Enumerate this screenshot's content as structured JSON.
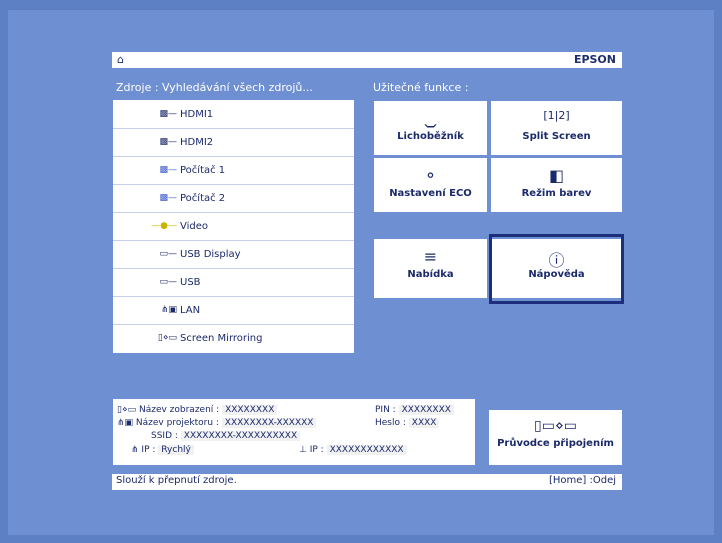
{
  "header": {
    "home_icon": "home-icon",
    "brand": "EPSON"
  },
  "sources": {
    "title": "Zdroje : Vyhledávání všech zdrojů...",
    "items": [
      {
        "label": "HDMI1",
        "icon": "hdmi-cable-icon"
      },
      {
        "label": "HDMI2",
        "icon": "hdmi-cable-icon"
      },
      {
        "label": "Počítač 1",
        "icon": "vga-cable-icon"
      },
      {
        "label": "Počítač 2",
        "icon": "vga-cable-icon"
      },
      {
        "label": "Video",
        "icon": "video-cable-icon"
      },
      {
        "label": "USB Display",
        "icon": "usb-display-cable-icon"
      },
      {
        "label": "USB",
        "icon": "usb-cable-icon"
      },
      {
        "label": "LAN",
        "icon": "lan-icon"
      },
      {
        "label": "Screen Mirroring",
        "icon": "screen-mirroring-icon"
      }
    ]
  },
  "functions": {
    "title": "Užitečné funkce :",
    "tiles": [
      {
        "label": "Lichoběžník",
        "icon": "keystone-icon"
      },
      {
        "label": "Split Screen",
        "icon": "split-screen-icon"
      },
      {
        "label": "Nastavení ECO",
        "icon": "eco-leaf-icon"
      },
      {
        "label": "Režim barev",
        "icon": "color-mode-icon"
      },
      {
        "label": "Nabídka",
        "icon": "menu-list-icon"
      },
      {
        "label": "Nápověda",
        "icon": "help-icon"
      }
    ]
  },
  "network": {
    "display_name_label": "Název zobrazení :",
    "display_name_value": "XXXXXXXX",
    "pin_label": "PIN :",
    "pin_value": "XXXXXXXX",
    "projector_name_label": "Název projektoru :",
    "projector_name_value": "XXXXXXXX-XXXXXX",
    "password_label": "Heslo :",
    "password_value": "XXXX",
    "ssid_label": "SSID :",
    "ssid_value": "XXXXXXXX-XXXXXXXXXX",
    "ip_wireless_label": "IP :",
    "ip_wireless_value": "Rychlý",
    "ip_wired_label": "IP :",
    "ip_wired_value": "XXXXXXXXXXXX"
  },
  "connection_guide": {
    "label": "Průvodce připojením",
    "icon": "connection-guide-icon"
  },
  "footer": {
    "hint": "Slouží k přepnutí zdroje.",
    "exit": "[Home] :Odej"
  }
}
